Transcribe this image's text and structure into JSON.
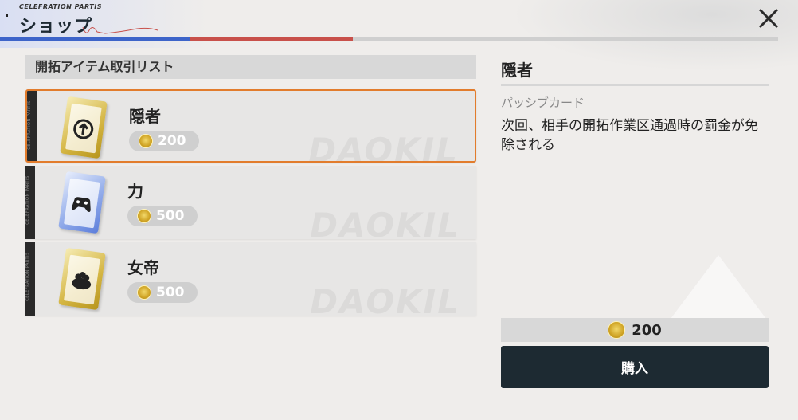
{
  "header": {
    "brand": "CELEFRATION PARTIS",
    "title": "ショップ"
  },
  "list": {
    "header": "開拓アイテム取引リスト",
    "stripe_text": "CELEFRATION PARTIS",
    "watermark": "DAOKIL",
    "items": [
      {
        "name": "隠者",
        "price": "200",
        "card_color": "gold",
        "icon": "arrow-up-circle-icon",
        "selected": true
      },
      {
        "name": "力",
        "price": "500",
        "card_color": "blue",
        "icon": "gamepad-icon",
        "selected": false
      },
      {
        "name": "女帝",
        "price": "500",
        "card_color": "gold",
        "icon": "crowd-icon",
        "selected": false
      }
    ]
  },
  "detail": {
    "name": "隠者",
    "type": "パッシブカード",
    "description": "次回、相手の開拓作業区通過時の罰金が免除される",
    "price": "200",
    "buy_label": "購入"
  },
  "colors": {
    "accent_orange": "#e27c2c",
    "progress_blue": "#3d64c9",
    "progress_red": "#c8504a",
    "buy_button": "#1d2a32"
  }
}
